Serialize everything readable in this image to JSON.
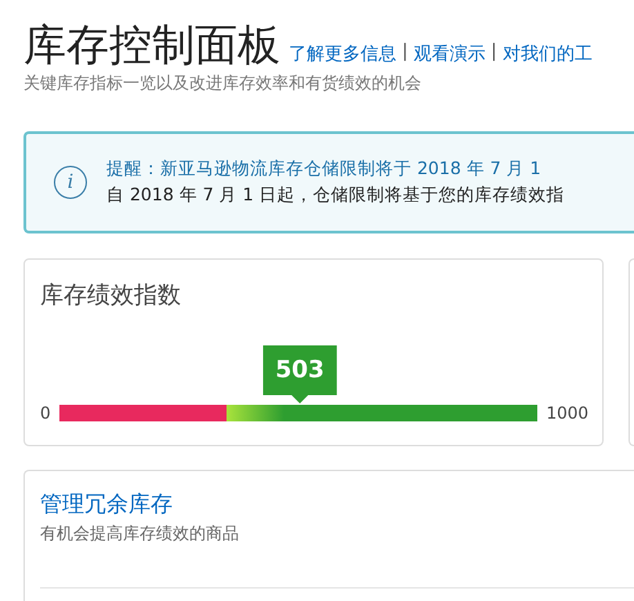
{
  "header": {
    "title": "库存控制面板",
    "links": [
      "了解更多信息",
      "观看演示",
      "对我们的工"
    ],
    "separator": "|",
    "subtitle": "关键库存指标一览以及改进库存效率和有货绩效的机会"
  },
  "alert": {
    "icon": "i",
    "lines": [
      "提醒：新亚马逊物流库存仓储限制将于 2018 年 7 月 1",
      "自 2018 年 7 月 1 日起，仓储限制将基于您的库存绩效指"
    ]
  },
  "performance_card": {
    "title": "库存绩效指数",
    "gauge": {
      "min": "0",
      "max": "1000",
      "score": "503",
      "level": 0.503
    }
  },
  "excess_card": {
    "title": "管理冗余库存",
    "subtitle": "有机会提高库存绩效的商品"
  }
}
